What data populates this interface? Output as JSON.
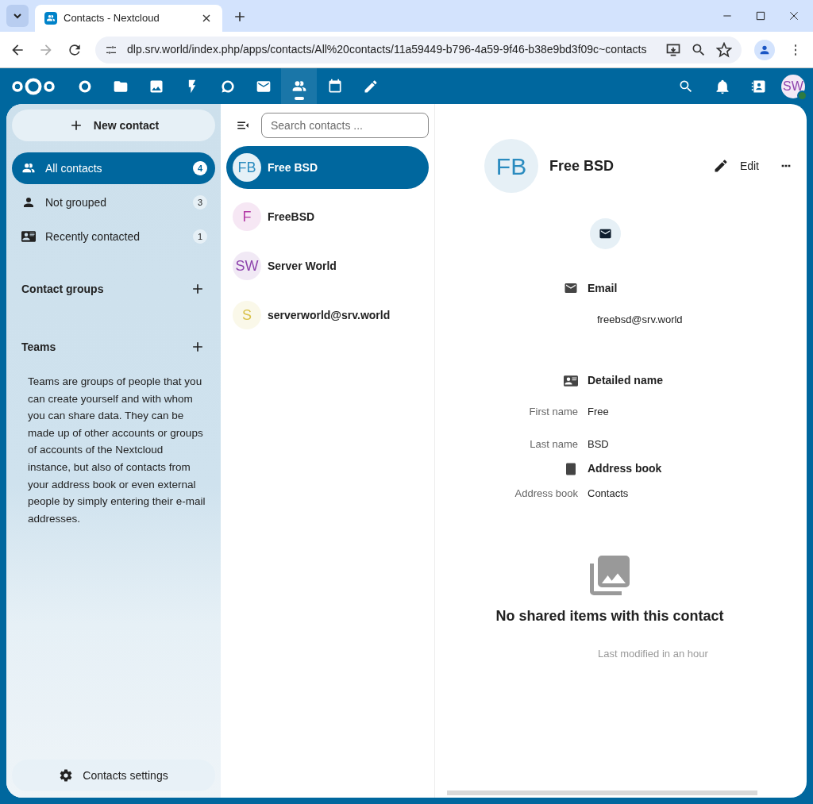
{
  "browser": {
    "tabs": [
      {
        "title": "Contacts - Nextcloud",
        "selected": true
      }
    ],
    "url": "dlp.srv.world/index.php/apps/contacts/All%20contacts/11a59449-b796-4a59-9f46-b38e9bd3f09c~contacts"
  },
  "header": {
    "apps": [
      {
        "kind": "dashboard",
        "selected": false
      },
      {
        "kind": "files",
        "selected": false
      },
      {
        "kind": "photos",
        "selected": false
      },
      {
        "kind": "activity",
        "selected": false
      },
      {
        "kind": "talk",
        "selected": false
      },
      {
        "kind": "mail",
        "selected": false
      },
      {
        "kind": "contacts",
        "selected": true
      },
      {
        "kind": "calendar",
        "selected": false
      },
      {
        "kind": "notes",
        "selected": false
      }
    ],
    "user_initials": "SW"
  },
  "sidebar": {
    "new_contact": "New contact",
    "items": [
      {
        "kind": "all",
        "label": "All contacts",
        "count": "4",
        "selected": true
      },
      {
        "kind": "ungrouped",
        "label": "Not grouped",
        "count": "3",
        "selected": false
      },
      {
        "kind": "recent",
        "label": "Recently contacted",
        "count": "1",
        "selected": false
      }
    ],
    "contact_groups": "Contact groups",
    "teams": "Teams",
    "teams_description": "Teams are groups of people that you can create yourself and with whom you can share data. They can be made up of other accounts or groups of accounts of the Nextcloud instance, but also of contacts from your address book or even external people by simply entering their e-mail addresses.",
    "settings": "Contacts settings"
  },
  "contact_list": {
    "search": {
      "placeholder": "Search contacts ..."
    },
    "contacts": [
      {
        "initials": "FB",
        "name": "Free BSD",
        "selected": true,
        "color": "#2a8bbf"
      },
      {
        "initials": "F",
        "name": "FreeBSD",
        "selected": false,
        "color": "#b339a5"
      },
      {
        "initials": "SW",
        "name": "Server World",
        "selected": false,
        "color": "#8e44ad"
      },
      {
        "initials": "S",
        "name": "serverworld@srv.world",
        "selected": false,
        "color": "#d9c14a"
      }
    ]
  },
  "details": {
    "initials": "FB",
    "name": "Free BSD",
    "edit": "Edit",
    "sections": [
      {
        "kind": "email",
        "title": "Email",
        "value": "freebsd@srv.world"
      },
      {
        "kind": "name",
        "title": "Detailed name",
        "rows": [
          {
            "label": "First name",
            "value": "Free"
          },
          {
            "label": "Last name",
            "value": "BSD"
          }
        ]
      },
      {
        "kind": "addressbook",
        "title": "Address book",
        "rows": [
          {
            "label": "Address book",
            "value": "Contacts"
          }
        ]
      }
    ],
    "shared_empty": "No shared items with this contact",
    "modified": "Last modified in an hour"
  }
}
